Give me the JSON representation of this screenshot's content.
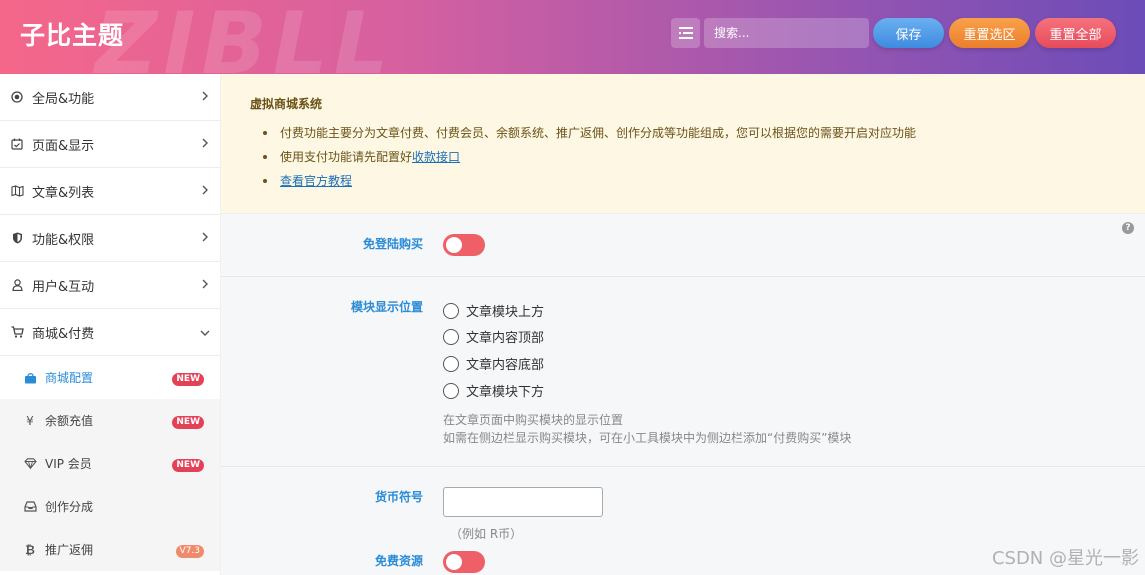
{
  "header": {
    "brand": "子比主题",
    "watermark": "ZIBLL",
    "search_placeholder": "搜索...",
    "save_label": "保存",
    "reset_selection_label": "重置选区",
    "reset_all_label": "重置全部"
  },
  "sidebar": {
    "items": [
      {
        "label": "全局&功能",
        "icon": "target-icon"
      },
      {
        "label": "页面&显示",
        "icon": "calendar-check-icon"
      },
      {
        "label": "文章&列表",
        "icon": "map-icon"
      },
      {
        "label": "功能&权限",
        "icon": "shield-icon"
      },
      {
        "label": "用户&互动",
        "icon": "user-icon"
      },
      {
        "label": "商城&付费",
        "icon": "cart-icon"
      }
    ],
    "subitems": [
      {
        "label": "商城配置",
        "icon": "shopping-bag-icon",
        "badge": "NEW",
        "active": true
      },
      {
        "label": "余额充值",
        "icon": "yen-icon",
        "badge": "NEW"
      },
      {
        "label": "VIP 会员",
        "icon": "diamond-icon",
        "badge": "NEW"
      },
      {
        "label": "创作分成",
        "icon": "inbox-icon",
        "badge": ""
      },
      {
        "label": "推广返佣",
        "icon": "bitcoin-icon",
        "badge": "V7.3"
      }
    ]
  },
  "notice": {
    "title": "虚拟商城系统",
    "line1": "付费功能主要分为文章付费、付费会员、余额系统、推广返佣、创作分成等功能组成，您可以根据您的需要开启对应功能",
    "line2_prefix": "使用支付功能请先配置好",
    "line2_link": "收款接口",
    "line3_link": "查看官方教程"
  },
  "fields": {
    "no_login_buy": {
      "label": "免登陆购买",
      "enabled": false
    },
    "module_position": {
      "label": "模块显示位置",
      "options": [
        "文章模块上方",
        "文章内容顶部",
        "文章内容底部",
        "文章模块下方"
      ],
      "desc1": "在文章页面中购买模块的显示位置",
      "desc2": "如需在侧边栏显示购买模块，可在小工具模块中为侧边栏添加“付费购买”模块"
    },
    "currency_symbol": {
      "label": "货币符号",
      "value": "",
      "hint": "（例如 R币）"
    },
    "free_resource": {
      "label": "免费资源",
      "enabled": false
    }
  },
  "help_icon": "?",
  "watermark_text": "CSDN @星光一影"
}
